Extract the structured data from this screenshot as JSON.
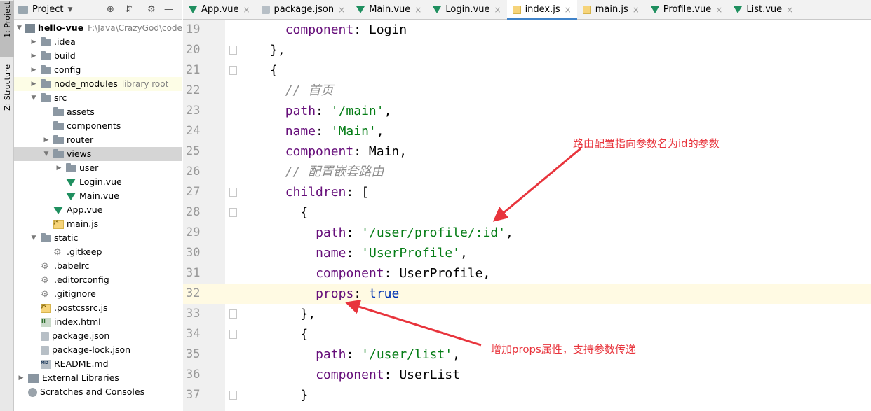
{
  "vertical_tabs": [
    {
      "label": "1: Project",
      "active": true
    },
    {
      "label": "Z: Structure",
      "active": false
    }
  ],
  "project_panel": {
    "title": "Project",
    "tree": [
      {
        "name": "hello-vue",
        "extra": "F:\\Java\\CrazyGod\\code\\",
        "icon": "module",
        "depth": 0,
        "arrow": "down",
        "bold": true
      },
      {
        "name": ".idea",
        "icon": "folder",
        "depth": 1,
        "arrow": "right"
      },
      {
        "name": "build",
        "icon": "folder",
        "depth": 1,
        "arrow": "right"
      },
      {
        "name": "config",
        "icon": "folder",
        "depth": 1,
        "arrow": "right"
      },
      {
        "name": "node_modules",
        "extra": "library root",
        "icon": "folder",
        "depth": 1,
        "arrow": "right",
        "lib": true
      },
      {
        "name": "src",
        "icon": "folder",
        "depth": 1,
        "arrow": "down"
      },
      {
        "name": "assets",
        "icon": "folder",
        "depth": 2,
        "arrow": "none"
      },
      {
        "name": "components",
        "icon": "folder",
        "depth": 2,
        "arrow": "none"
      },
      {
        "name": "router",
        "icon": "folder",
        "depth": 2,
        "arrow": "right"
      },
      {
        "name": "views",
        "icon": "folder",
        "depth": 2,
        "arrow": "down",
        "selected": true
      },
      {
        "name": "user",
        "icon": "folder",
        "depth": 3,
        "arrow": "right"
      },
      {
        "name": "Login.vue",
        "icon": "vue",
        "depth": 3,
        "arrow": "none"
      },
      {
        "name": "Main.vue",
        "icon": "vue",
        "depth": 3,
        "arrow": "none"
      },
      {
        "name": "App.vue",
        "icon": "vue",
        "depth": 2,
        "arrow": "none"
      },
      {
        "name": "main.js",
        "icon": "js",
        "depth": 2,
        "arrow": "none"
      },
      {
        "name": "static",
        "icon": "folder",
        "depth": 1,
        "arrow": "down"
      },
      {
        "name": ".gitkeep",
        "icon": "gear",
        "depth": 2,
        "arrow": "none"
      },
      {
        "name": ".babelrc",
        "icon": "gear",
        "depth": 1,
        "arrow": "none"
      },
      {
        "name": ".editorconfig",
        "icon": "gear",
        "depth": 1,
        "arrow": "none"
      },
      {
        "name": ".gitignore",
        "icon": "gear",
        "depth": 1,
        "arrow": "none"
      },
      {
        "name": ".postcssrc.js",
        "icon": "js",
        "depth": 1,
        "arrow": "none"
      },
      {
        "name": "index.html",
        "icon": "html",
        "depth": 1,
        "arrow": "none"
      },
      {
        "name": "package.json",
        "icon": "file",
        "depth": 1,
        "arrow": "none"
      },
      {
        "name": "package-lock.json",
        "icon": "file",
        "depth": 1,
        "arrow": "none"
      },
      {
        "name": "README.md",
        "icon": "md",
        "depth": 1,
        "arrow": "none"
      },
      {
        "name": "External Libraries",
        "icon": "lib",
        "depth": 0,
        "arrow": "right"
      },
      {
        "name": "Scratches and Consoles",
        "icon": "scratch",
        "depth": 0,
        "arrow": "none"
      }
    ]
  },
  "tabs": [
    {
      "label": "App.vue",
      "icon": "vue",
      "active": false
    },
    {
      "label": "package.json",
      "icon": "json",
      "active": false
    },
    {
      "label": "Main.vue",
      "icon": "vue",
      "active": false
    },
    {
      "label": "Login.vue",
      "icon": "vue",
      "active": false
    },
    {
      "label": "index.js",
      "icon": "js",
      "active": true
    },
    {
      "label": "main.js",
      "icon": "js",
      "active": false
    },
    {
      "label": "Profile.vue",
      "icon": "vue",
      "active": false
    },
    {
      "label": "List.vue",
      "icon": "vue",
      "active": false
    }
  ],
  "editor": {
    "current_line": "32",
    "lines": [
      {
        "n": "19",
        "indent": 1,
        "fold": false,
        "tokens": [
          [
            "k",
            "component"
          ],
          [
            "p",
            ": Login"
          ]
        ]
      },
      {
        "n": "20",
        "indent": 0,
        "fold": true,
        "tokens": [
          [
            "p",
            "},"
          ]
        ]
      },
      {
        "n": "21",
        "indent": 0,
        "fold": true,
        "tokens": [
          [
            "p",
            "{"
          ]
        ]
      },
      {
        "n": "22",
        "indent": 1,
        "fold": false,
        "tokens": [
          [
            "cm",
            "// 首页"
          ]
        ]
      },
      {
        "n": "23",
        "indent": 1,
        "fold": false,
        "tokens": [
          [
            "k",
            "path"
          ],
          [
            "p",
            ": "
          ],
          [
            "s",
            "'/main'"
          ],
          [
            "p",
            ","
          ]
        ]
      },
      {
        "n": "24",
        "indent": 1,
        "fold": false,
        "tokens": [
          [
            "k",
            "name"
          ],
          [
            "p",
            ": "
          ],
          [
            "s",
            "'Main'"
          ],
          [
            "p",
            ","
          ]
        ]
      },
      {
        "n": "25",
        "indent": 1,
        "fold": false,
        "tokens": [
          [
            "k",
            "component"
          ],
          [
            "p",
            ": Main,"
          ]
        ]
      },
      {
        "n": "26",
        "indent": 1,
        "fold": false,
        "tokens": [
          [
            "cm",
            "// 配置嵌套路由"
          ]
        ]
      },
      {
        "n": "27",
        "indent": 1,
        "fold": true,
        "tokens": [
          [
            "k",
            "children"
          ],
          [
            "p",
            ": ["
          ]
        ]
      },
      {
        "n": "28",
        "indent": 2,
        "fold": true,
        "tokens": [
          [
            "p",
            "{"
          ]
        ]
      },
      {
        "n": "29",
        "indent": 3,
        "fold": false,
        "tokens": [
          [
            "k",
            "path"
          ],
          [
            "p",
            ": "
          ],
          [
            "s",
            "'/user/profile/:id'"
          ],
          [
            "p",
            ","
          ]
        ]
      },
      {
        "n": "30",
        "indent": 3,
        "fold": false,
        "tokens": [
          [
            "k",
            "name"
          ],
          [
            "p",
            ": "
          ],
          [
            "s",
            "'UserProfile'"
          ],
          [
            "p",
            ","
          ]
        ]
      },
      {
        "n": "31",
        "indent": 3,
        "fold": false,
        "tokens": [
          [
            "k",
            "component"
          ],
          [
            "p",
            ": UserProfile,"
          ]
        ]
      },
      {
        "n": "32",
        "indent": 3,
        "fold": false,
        "tokens": [
          [
            "k",
            "props"
          ],
          [
            "p",
            ": "
          ],
          [
            "kw",
            "true"
          ]
        ]
      },
      {
        "n": "33",
        "indent": 2,
        "fold": true,
        "tokens": [
          [
            "p",
            "},"
          ]
        ]
      },
      {
        "n": "34",
        "indent": 2,
        "fold": true,
        "tokens": [
          [
            "p",
            "{"
          ]
        ]
      },
      {
        "n": "35",
        "indent": 3,
        "fold": false,
        "tokens": [
          [
            "k",
            "path"
          ],
          [
            "p",
            ": "
          ],
          [
            "s",
            "'/user/list'"
          ],
          [
            "p",
            ","
          ]
        ]
      },
      {
        "n": "36",
        "indent": 3,
        "fold": false,
        "tokens": [
          [
            "k",
            "component"
          ],
          [
            "p",
            ": UserList"
          ]
        ]
      },
      {
        "n": "37",
        "indent": 2,
        "fold": true,
        "tokens": [
          [
            "p",
            "}"
          ]
        ]
      }
    ]
  },
  "annotations": {
    "top": "路由配置指向参数名为id的参数",
    "bottom": "增加props属性，支持参数传递",
    "color": "#e8343c"
  }
}
